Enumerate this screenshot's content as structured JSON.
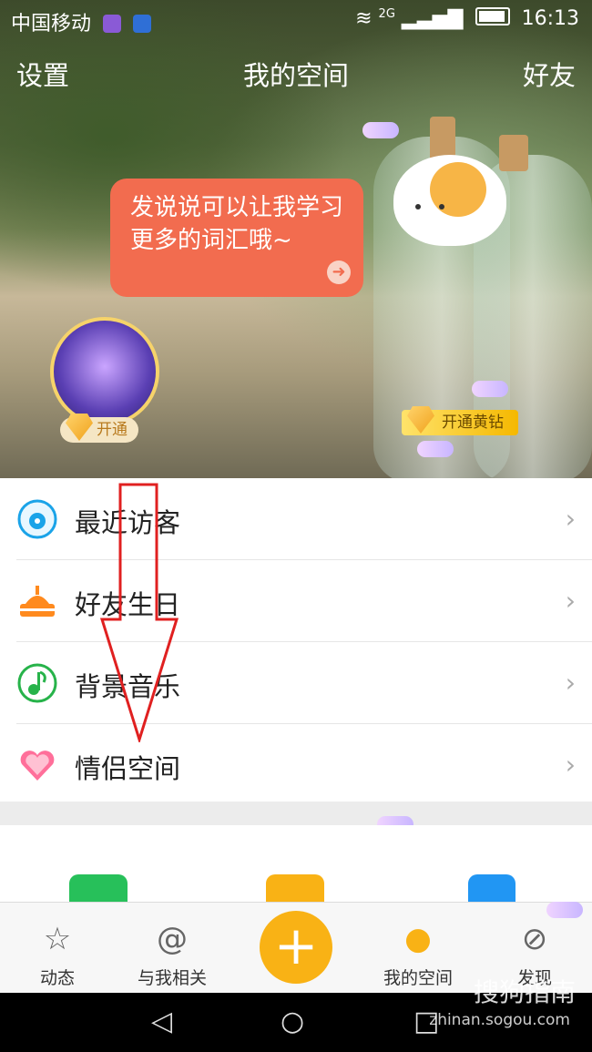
{
  "status": {
    "carrier": "中国移动",
    "network": "2G",
    "time": "16:13"
  },
  "topbar": {
    "left": "设置",
    "title": "我的空间",
    "right": "好友"
  },
  "bubble": {
    "text": "发说说可以让我学习更多的词汇哦~"
  },
  "badges": {
    "open": "开通",
    "gold": "开通黄钻"
  },
  "menu": [
    {
      "label": "最近访客",
      "icon": "eye-icon"
    },
    {
      "label": "好友生日",
      "icon": "cake-icon"
    },
    {
      "label": "背景音乐",
      "icon": "music-note-icon"
    },
    {
      "label": "情侣空间",
      "icon": "hearts-icon"
    }
  ],
  "tabbar": {
    "tabs": [
      {
        "label": "动态",
        "icon": "star-icon"
      },
      {
        "label": "与我相关",
        "icon": "at-icon"
      },
      {
        "label": "我的空间",
        "icon": "person-icon"
      },
      {
        "label": "发现",
        "icon": "compass-icon"
      }
    ],
    "plus": "+"
  },
  "watermark": {
    "brand": "搜狗指南",
    "url": "zhinan.sogou.com"
  },
  "colors": {
    "accent": "#f9b215",
    "bubble": "#f26c4f",
    "arrow": "#e02020"
  }
}
